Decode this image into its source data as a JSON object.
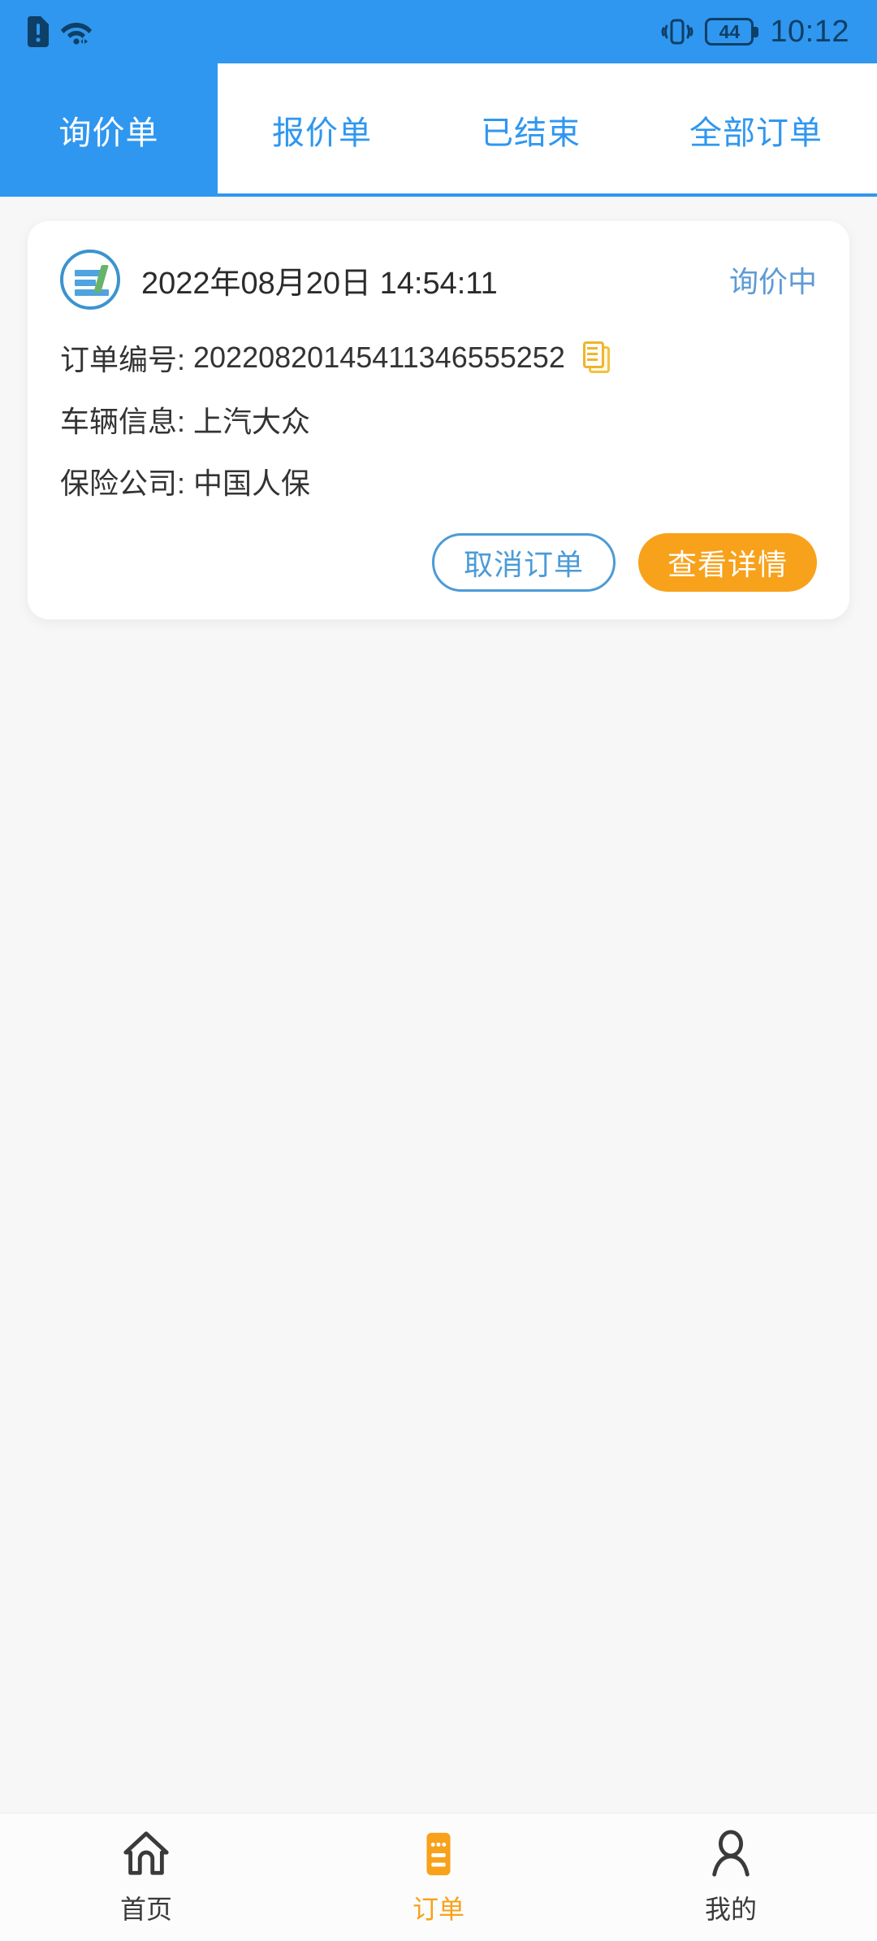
{
  "status_bar": {
    "time": "10:12",
    "battery_level": "44",
    "icons": [
      "sim-alert-icon",
      "wifi-icon",
      "vibrate-icon",
      "battery-icon"
    ]
  },
  "tabs": [
    {
      "label": "询价单",
      "active": true
    },
    {
      "label": "报价单",
      "active": false
    },
    {
      "label": "已结束",
      "active": false
    },
    {
      "label": "全部订单",
      "active": false
    }
  ],
  "order_card": {
    "logo_icon": "company-logo-icon",
    "date": "2022年08月20日 14:54:11",
    "status": "询价中",
    "rows": [
      {
        "label": "订单编号:",
        "value": "20220820145411346555252",
        "copy_icon": "copy-icon"
      },
      {
        "label": "车辆信息:",
        "value": "上汽大众"
      },
      {
        "label": "保险公司:",
        "value": "中国人保"
      }
    ],
    "cancel_label": "取消订单",
    "detail_label": "查看详情"
  },
  "bottom_nav": [
    {
      "label": "首页",
      "icon": "home-icon",
      "active": false
    },
    {
      "label": "订单",
      "icon": "order-list-icon",
      "active": true
    },
    {
      "label": "我的",
      "icon": "person-icon",
      "active": false
    }
  ],
  "colors": {
    "brand_blue": "#2F97EF",
    "accent_orange": "#F8A11A",
    "status_blue": "#5E9BD4",
    "page_bg": "#F7F7F7"
  }
}
